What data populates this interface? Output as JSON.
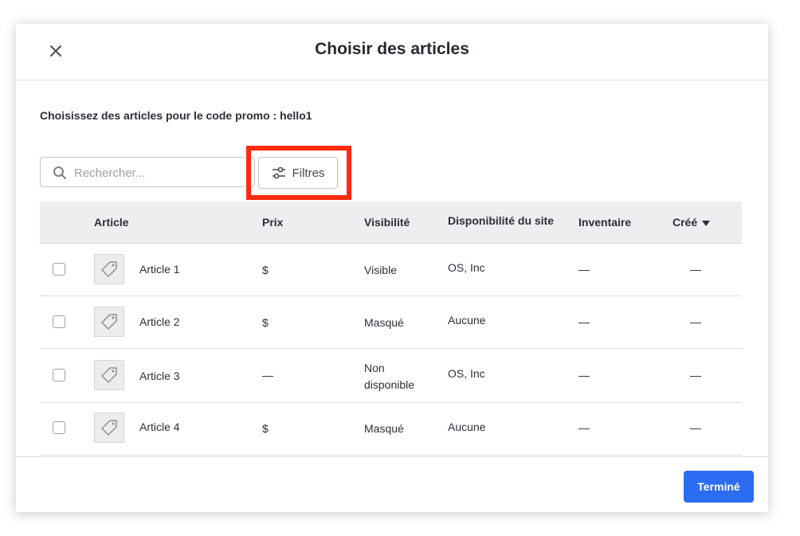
{
  "modal": {
    "title": "Choisir des articles",
    "close_icon": "close-icon"
  },
  "subtitle": "Choisissez des articles pour le code promo : hello1",
  "search": {
    "placeholder": "Rechercher...",
    "value": "",
    "icon": "search-icon"
  },
  "filters": {
    "label": "Filtres",
    "icon": "sliders-icon",
    "highlight_color": "#ff2a0e"
  },
  "table": {
    "headers": {
      "article": "Article",
      "prix": "Prix",
      "visibilite": "Visibilité",
      "disponibilite": "Disponibilité du site",
      "inventaire": "Inventaire",
      "cree": "Créé"
    },
    "rows": [
      {
        "name": "Article 1",
        "prix": "$",
        "visibilite": "Visible",
        "disponibilite": "OS, Inc",
        "inventaire": "—",
        "cree": "—"
      },
      {
        "name": "Article 2",
        "prix": "$",
        "visibilite": "Masqué",
        "disponibilite": "Aucune",
        "inventaire": "—",
        "cree": "—"
      },
      {
        "name": "Article 3",
        "prix": "—",
        "visibilite": "Non disponible",
        "disponibilite": "OS, Inc",
        "inventaire": "—",
        "cree": "—"
      },
      {
        "name": "Article 4",
        "prix": "$",
        "visibilite": "Masqué",
        "disponibilite": "Aucune",
        "inventaire": "—",
        "cree": "—"
      }
    ]
  },
  "footer": {
    "done_label": "Terminé"
  },
  "colors": {
    "accent": "#2b6cf2",
    "header_bg": "#eceef0"
  }
}
